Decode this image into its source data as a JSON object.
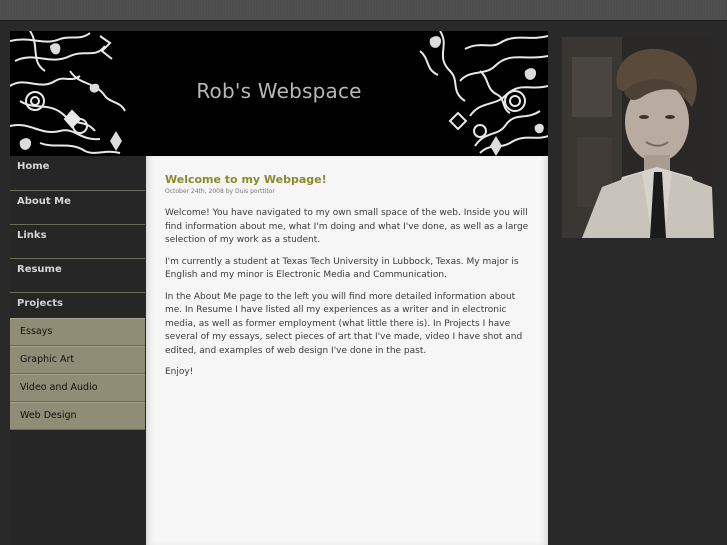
{
  "site": {
    "title": "Rob's Webspace"
  },
  "nav": {
    "items": [
      {
        "label": "Home"
      },
      {
        "label": "About Me"
      },
      {
        "label": "Links"
      },
      {
        "label": "Resume"
      },
      {
        "label": "Projects"
      }
    ],
    "projects_sub": [
      {
        "label": "Essays"
      },
      {
        "label": "Graphic Art"
      },
      {
        "label": "Video and Audio"
      },
      {
        "label": "Web Design"
      }
    ]
  },
  "post": {
    "title": "Welcome to my Webpage!",
    "meta": "October 24th, 2008 by Duis porttitor",
    "paragraphs": [
      "Welcome! You have navigated to my own small space of the web. Inside you will find information about me, what I'm doing and what I've done, as well as a large selection of my work as a student.",
      "I'm currently a student at Texas Tech University in Lubbock, Texas. My major is English and my minor is Electronic Media and Communication.",
      "In the About Me page to the left you will find more detailed information about me. In Resume I have listed all my experiences as a writer and in electronic media, as well as former employment (what little there is). In Projects I have several of my essays, select pieces of art that I've made, video I have shot and edited, and examples of web design I've done in the past.",
      "Enjoy!"
    ]
  },
  "colors": {
    "accent": "#8a8a2e",
    "submenu_bg": "#8f8d75",
    "background": "#262626"
  }
}
